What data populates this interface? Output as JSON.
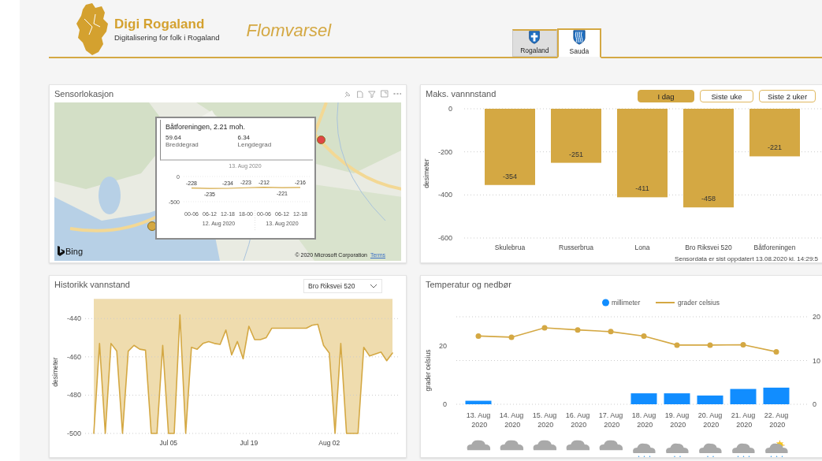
{
  "header": {
    "logo_title": "Digi Rogaland",
    "logo_subtitle": "Digitalisering for folk i Rogaland",
    "title": "Flomvarsel",
    "tabs": [
      {
        "label": "Rogaland",
        "selected": false,
        "kind": "cross"
      },
      {
        "label": "Sauda",
        "selected": true,
        "kind": "waves"
      }
    ]
  },
  "map_card": {
    "title": "Sensorlokasjon",
    "markers": [
      {
        "color": "#d4a843"
      },
      {
        "color": "#e04545"
      }
    ],
    "tooltip": {
      "title": "Båtforeningen, 2.21 moh.",
      "fields": [
        {
          "value": "59.64",
          "label": "Breddegrad"
        },
        {
          "value": "6.34",
          "label": "Lengdegrad"
        }
      ],
      "chart_data": {
        "type": "line",
        "title": "13. Aug 2020",
        "categories": [
          "00-06",
          "06-12",
          "12-18",
          "18-00",
          "00-06",
          "06-12",
          "12-18"
        ],
        "values": [
          -228,
          -235,
          -234,
          -223,
          -212,
          -221,
          -216
        ],
        "ylim": [
          -500,
          0
        ],
        "yticks": [
          0,
          -500
        ],
        "data_labels": true
      },
      "x_groups": [
        "12. Aug 2020",
        "13. Aug 2020"
      ]
    },
    "bing_label": "Bing",
    "attribution": "© 2020 Microsoft Corporation",
    "terms_link": "Terms"
  },
  "level_card": {
    "title": "Maks. vannnstand",
    "buttons": [
      {
        "label": "I dag",
        "selected": true
      },
      {
        "label": "Siste uke",
        "selected": false
      },
      {
        "label": "Siste 2 uker",
        "selected": false
      }
    ],
    "chart_data": {
      "type": "bar",
      "ylabel": "desimeter",
      "categories": [
        "Skulebrua",
        "Russerbrua",
        "Lona",
        "Bro Riksvei 520",
        "Båtforeningen"
      ],
      "values": [
        -354,
        -251,
        -411,
        -458,
        -221
      ],
      "ylim": [
        -600,
        0
      ],
      "yticks": [
        0,
        -200,
        -400,
        -600
      ],
      "data_labels": true
    },
    "footer": "Sensordata er sist oppdatert 13.08.2020 kl. 14:29:5"
  },
  "history_card": {
    "title": "Historikk vannstand",
    "dropdown": "Bro Riksvei 520",
    "chart_data": {
      "type": "area",
      "grid": true,
      "ylabel": "desimeter",
      "categories": [
        null,
        null,
        null,
        null,
        null,
        null,
        null,
        null,
        null,
        null,
        null,
        null,
        null,
        "Jul 05",
        null,
        null,
        null,
        null,
        null,
        null,
        null,
        null,
        null,
        null,
        null,
        null,
        null,
        "Jul 19",
        null,
        null,
        null,
        null,
        null,
        null,
        null,
        null,
        null,
        null,
        null,
        null,
        null,
        "Aug 02",
        null,
        null,
        null,
        null,
        null,
        null,
        null,
        null,
        null,
        null,
        null
      ],
      "values": [
        -500,
        -453,
        -500,
        -453,
        -457,
        -500,
        -457,
        -454,
        -456,
        -456.5,
        -500,
        -500,
        -454,
        -500,
        -500,
        -438,
        -500,
        -455,
        -456,
        -453,
        -452,
        -453,
        -453.5,
        -446,
        -459,
        -452,
        -461,
        -444,
        -451,
        -451,
        -450,
        -445,
        -445,
        -445,
        -445,
        -445,
        -445,
        -445,
        -443.5,
        -443,
        -454,
        -458,
        -500,
        -453,
        -500,
        -500,
        -500,
        -455,
        -459.5,
        -458.5,
        -457.5,
        -462,
        -458
      ],
      "ylim": [
        -500,
        -430
      ],
      "yticks": [
        -440,
        -460,
        -480,
        -500
      ]
    }
  },
  "weather_card": {
    "title": "Temperatur og nedbør",
    "chart_data": {
      "type": "bar",
      "ylabel": "grader celsius",
      "categories": [
        "13. Aug 2020",
        "14. Aug 2020",
        "15. Aug 2020",
        "16. Aug 2020",
        "17. Aug 2020",
        "18. Aug 2020",
        "19. Aug 2020",
        "20. Aug 2020",
        "21. Aug 2020",
        "22. Aug 2020"
      ],
      "series": [
        {
          "name": "millimeter",
          "color": "#118dff",
          "type": "bar",
          "axis": "y2",
          "values": [
            0.8,
            0,
            0,
            0,
            0,
            2.5,
            2.5,
            2.0,
            3.5,
            3.8
          ]
        },
        {
          "name": "grader celsius",
          "color": "#d4a843",
          "type": "line",
          "marker": "circle",
          "axis": "y",
          "values": [
            23.4,
            23.0,
            26.2,
            25.5,
            24.9,
            23.4,
            20.3,
            20.3,
            20.4,
            18.0
          ]
        }
      ],
      "legend": "top",
      "ylim": [
        0,
        30
      ],
      "yticks": [
        0,
        20
      ],
      "y2lim": [
        0,
        20
      ],
      "y2ticks": [
        0,
        10,
        20
      ]
    },
    "weather": [
      {
        "kind": "cloud"
      },
      {
        "kind": "cloud"
      },
      {
        "kind": "cloud"
      },
      {
        "kind": "cloud"
      },
      {
        "kind": "cloud"
      },
      {
        "kind": "rain3"
      },
      {
        "kind": "rain2"
      },
      {
        "kind": "rain2"
      },
      {
        "kind": "rain3"
      },
      {
        "kind": "sunrain"
      }
    ]
  }
}
